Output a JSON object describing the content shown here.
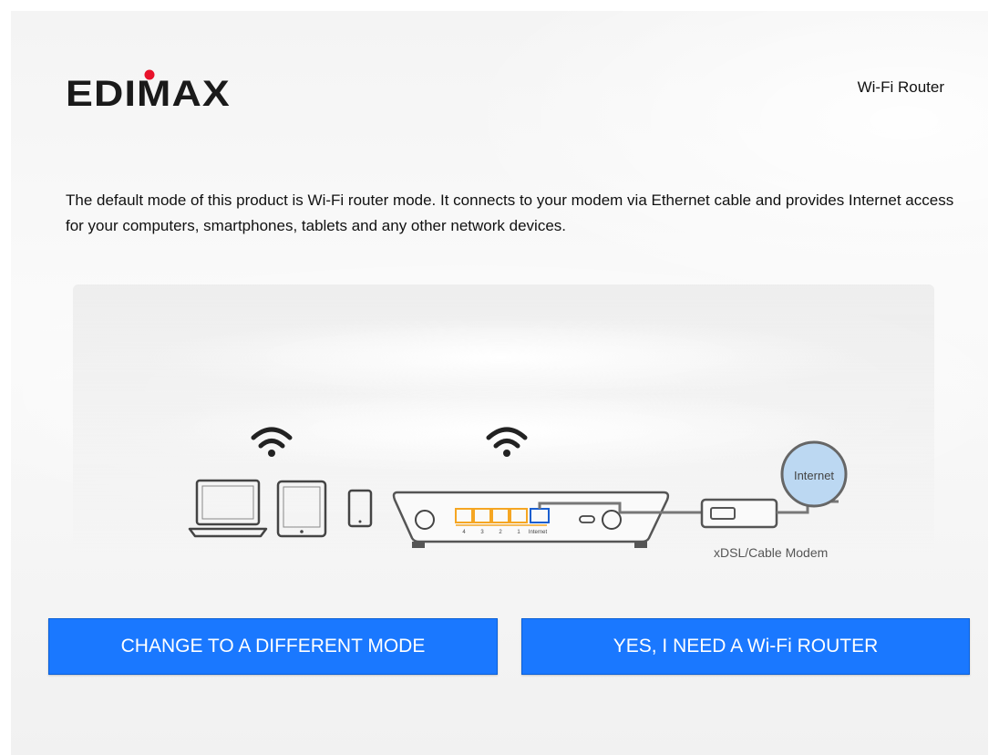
{
  "brand": {
    "logo_text": "EDIMAX",
    "logo_dot_color": "#e8122a"
  },
  "header": {
    "product_name": "Wi-Fi Router"
  },
  "main": {
    "description": "The default mode of this product is Wi-Fi router mode. It connects to your modem via Ethernet cable and provides Internet access for your computers, smartphones, tablets and any other network devices."
  },
  "diagram": {
    "ports": [
      "4",
      "3",
      "2",
      "1",
      "Internet"
    ],
    "internet_label": "Internet",
    "modem_label": "xDSL/Cable Modem",
    "icons": [
      "wifi-icon",
      "laptop-icon",
      "tablet-icon",
      "smartphone-icon",
      "router-icon",
      "modem-icon",
      "internet-globe-icon"
    ]
  },
  "actions": {
    "change_mode_label": "CHANGE TO A DIFFERENT MODE",
    "confirm_label": "YES, I NEED A Wi-Fi ROUTER"
  },
  "colors": {
    "button_blue": "#1a78ff",
    "port_orange": "#f5a623",
    "port_blue": "#1a5fd0",
    "globe_blue": "#bcd8f2"
  }
}
